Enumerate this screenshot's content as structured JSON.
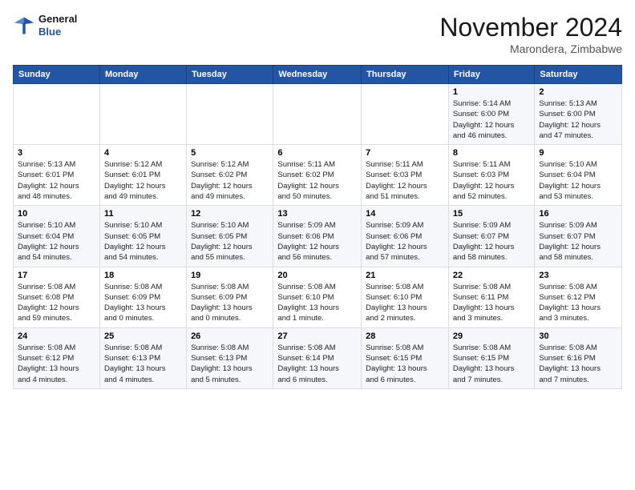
{
  "header": {
    "logo_line1": "General",
    "logo_line2": "Blue",
    "month": "November 2024",
    "location": "Marondera, Zimbabwe"
  },
  "weekdays": [
    "Sunday",
    "Monday",
    "Tuesday",
    "Wednesday",
    "Thursday",
    "Friday",
    "Saturday"
  ],
  "weeks": [
    [
      {
        "day": "",
        "info": ""
      },
      {
        "day": "",
        "info": ""
      },
      {
        "day": "",
        "info": ""
      },
      {
        "day": "",
        "info": ""
      },
      {
        "day": "",
        "info": ""
      },
      {
        "day": "1",
        "info": "Sunrise: 5:14 AM\nSunset: 6:00 PM\nDaylight: 12 hours\nand 46 minutes."
      },
      {
        "day": "2",
        "info": "Sunrise: 5:13 AM\nSunset: 6:00 PM\nDaylight: 12 hours\nand 47 minutes."
      }
    ],
    [
      {
        "day": "3",
        "info": "Sunrise: 5:13 AM\nSunset: 6:01 PM\nDaylight: 12 hours\nand 48 minutes."
      },
      {
        "day": "4",
        "info": "Sunrise: 5:12 AM\nSunset: 6:01 PM\nDaylight: 12 hours\nand 49 minutes."
      },
      {
        "day": "5",
        "info": "Sunrise: 5:12 AM\nSunset: 6:02 PM\nDaylight: 12 hours\nand 49 minutes."
      },
      {
        "day": "6",
        "info": "Sunrise: 5:11 AM\nSunset: 6:02 PM\nDaylight: 12 hours\nand 50 minutes."
      },
      {
        "day": "7",
        "info": "Sunrise: 5:11 AM\nSunset: 6:03 PM\nDaylight: 12 hours\nand 51 minutes."
      },
      {
        "day": "8",
        "info": "Sunrise: 5:11 AM\nSunset: 6:03 PM\nDaylight: 12 hours\nand 52 minutes."
      },
      {
        "day": "9",
        "info": "Sunrise: 5:10 AM\nSunset: 6:04 PM\nDaylight: 12 hours\nand 53 minutes."
      }
    ],
    [
      {
        "day": "10",
        "info": "Sunrise: 5:10 AM\nSunset: 6:04 PM\nDaylight: 12 hours\nand 54 minutes."
      },
      {
        "day": "11",
        "info": "Sunrise: 5:10 AM\nSunset: 6:05 PM\nDaylight: 12 hours\nand 54 minutes."
      },
      {
        "day": "12",
        "info": "Sunrise: 5:10 AM\nSunset: 6:05 PM\nDaylight: 12 hours\nand 55 minutes."
      },
      {
        "day": "13",
        "info": "Sunrise: 5:09 AM\nSunset: 6:06 PM\nDaylight: 12 hours\nand 56 minutes."
      },
      {
        "day": "14",
        "info": "Sunrise: 5:09 AM\nSunset: 6:06 PM\nDaylight: 12 hours\nand 57 minutes."
      },
      {
        "day": "15",
        "info": "Sunrise: 5:09 AM\nSunset: 6:07 PM\nDaylight: 12 hours\nand 58 minutes."
      },
      {
        "day": "16",
        "info": "Sunrise: 5:09 AM\nSunset: 6:07 PM\nDaylight: 12 hours\nand 58 minutes."
      }
    ],
    [
      {
        "day": "17",
        "info": "Sunrise: 5:08 AM\nSunset: 6:08 PM\nDaylight: 12 hours\nand 59 minutes."
      },
      {
        "day": "18",
        "info": "Sunrise: 5:08 AM\nSunset: 6:09 PM\nDaylight: 13 hours\nand 0 minutes."
      },
      {
        "day": "19",
        "info": "Sunrise: 5:08 AM\nSunset: 6:09 PM\nDaylight: 13 hours\nand 0 minutes."
      },
      {
        "day": "20",
        "info": "Sunrise: 5:08 AM\nSunset: 6:10 PM\nDaylight: 13 hours\nand 1 minute."
      },
      {
        "day": "21",
        "info": "Sunrise: 5:08 AM\nSunset: 6:10 PM\nDaylight: 13 hours\nand 2 minutes."
      },
      {
        "day": "22",
        "info": "Sunrise: 5:08 AM\nSunset: 6:11 PM\nDaylight: 13 hours\nand 3 minutes."
      },
      {
        "day": "23",
        "info": "Sunrise: 5:08 AM\nSunset: 6:12 PM\nDaylight: 13 hours\nand 3 minutes."
      }
    ],
    [
      {
        "day": "24",
        "info": "Sunrise: 5:08 AM\nSunset: 6:12 PM\nDaylight: 13 hours\nand 4 minutes."
      },
      {
        "day": "25",
        "info": "Sunrise: 5:08 AM\nSunset: 6:13 PM\nDaylight: 13 hours\nand 4 minutes."
      },
      {
        "day": "26",
        "info": "Sunrise: 5:08 AM\nSunset: 6:13 PM\nDaylight: 13 hours\nand 5 minutes."
      },
      {
        "day": "27",
        "info": "Sunrise: 5:08 AM\nSunset: 6:14 PM\nDaylight: 13 hours\nand 6 minutes."
      },
      {
        "day": "28",
        "info": "Sunrise: 5:08 AM\nSunset: 6:15 PM\nDaylight: 13 hours\nand 6 minutes."
      },
      {
        "day": "29",
        "info": "Sunrise: 5:08 AM\nSunset: 6:15 PM\nDaylight: 13 hours\nand 7 minutes."
      },
      {
        "day": "30",
        "info": "Sunrise: 5:08 AM\nSunset: 6:16 PM\nDaylight: 13 hours\nand 7 minutes."
      }
    ]
  ]
}
